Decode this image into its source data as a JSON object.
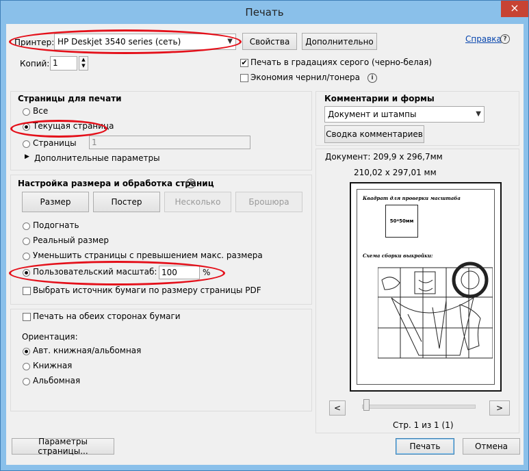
{
  "window": {
    "title": "Печать",
    "close_glyph": "×"
  },
  "printer": {
    "label": "Принтер:",
    "value": "HP Deskjet 3540 series (сеть)",
    "properties_button": "Свойства",
    "advanced_button": "Дополнительно",
    "help_link": "Справка",
    "copies_label": "Копий:",
    "copies_value": "1",
    "grayscale_label": "Печать в градациях серого (черно-белая)",
    "grayscale_checked": true,
    "save_ink_label": "Экономия чернил/тонера",
    "save_ink_checked": false
  },
  "pages": {
    "header": "Страницы для печати",
    "all_label": "Все",
    "current_label": "Текущая страница",
    "pages_label": "Страницы",
    "pages_value": "1",
    "more_options": "Дополнительные параметры",
    "selected": "current"
  },
  "sizing": {
    "header": "Настройка размера и обработка страниц",
    "buttons": {
      "size": "Размер",
      "poster": "Постер",
      "multiple": "Несколько",
      "booklet": "Брошюра"
    },
    "fit_label": "Подогнать",
    "actual_label": "Реальный размер",
    "shrink_label": "Уменьшить страницы с превышением макс. размера",
    "custom_label": "Пользовательский масштаб:",
    "custom_value": "100",
    "percent": "%",
    "paper_source_label": "Выбрать источник бумаги по размеру страницы PDF",
    "selected": "custom"
  },
  "duplex": {
    "both_sides_label": "Печать на обеих сторонах бумаги",
    "orientation_label": "Ориентация:",
    "auto_label": "Авт. книжная/альбомная",
    "portrait_label": "Книжная",
    "landscape_label": "Альбомная",
    "selected": "auto"
  },
  "comments": {
    "header": "Комментарии и формы",
    "select_value": "Документ и штампы",
    "summary_button": "Сводка комментариев"
  },
  "preview": {
    "document_size": "Документ: 209,9 x 296,7мм",
    "paper_size": "210,02 x 297,01 мм",
    "heading1": "Квадрат для проверки масштаба",
    "square_label": "50*50мм",
    "heading2": "Схема сборки выкройки:",
    "prev_button": "<",
    "next_button": ">",
    "page_indicator": "Стр. 1 из 1 (1)"
  },
  "footer": {
    "page_setup_button": "Параметры страницы...",
    "print_button": "Печать",
    "cancel_button": "Отмена"
  },
  "colors": {
    "annotation_red": "#e4101a",
    "title_bg": "#8ac0ea",
    "close_red": "#c74333"
  }
}
